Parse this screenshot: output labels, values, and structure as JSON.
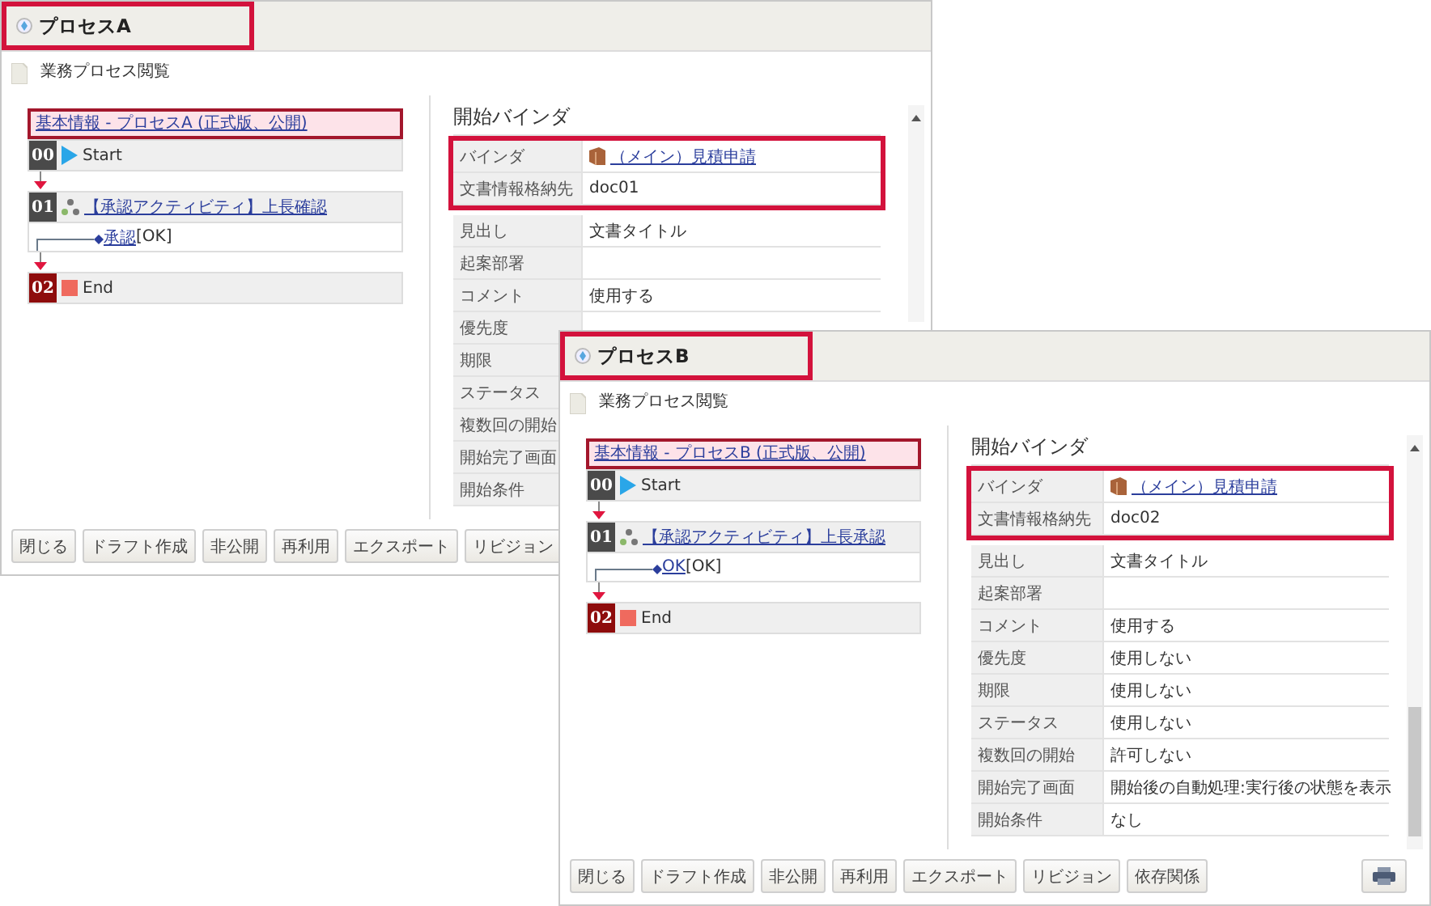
{
  "windows": [
    {
      "title": "プロセスA",
      "title_highlighted": true,
      "subtitle": "業務プロセス閲覧",
      "flow": {
        "header": "基本情報 - プロセスA (正式版、公開)",
        "steps": [
          {
            "number": "00",
            "kind": "start",
            "label": "Start"
          },
          {
            "number": "01",
            "kind": "activity",
            "label": "【承認アクティビティ】上長確認",
            "branch": {
              "link": "承認",
              "suffix": "[OK]"
            }
          },
          {
            "number": "02",
            "kind": "end",
            "label": "End"
          }
        ]
      },
      "panel": {
        "heading": "開始バインダ",
        "sections": [
          {
            "highlighted": true,
            "rows": [
              {
                "label": "バインダ",
                "kind": "link",
                "value": "（メイン）見積申請"
              },
              {
                "label": "文書情報格納先",
                "kind": "text",
                "value": "doc01"
              }
            ]
          },
          {
            "highlighted": false,
            "rows": [
              {
                "label": "見出し",
                "kind": "text",
                "value": "文書タイトル"
              },
              {
                "label": "起案部署",
                "kind": "text"
              },
              {
                "label": "コメント",
                "kind": "text",
                "value": "使用する"
              },
              {
                "label": "優先度",
                "kind": "text"
              },
              {
                "label": "期限",
                "kind": "text"
              },
              {
                "label": "ステータス",
                "kind": "text"
              },
              {
                "label": "複数回の開始",
                "kind": "text"
              },
              {
                "label": "開始完了画面",
                "kind": "text"
              },
              {
                "label": "開始条件",
                "kind": "text"
              }
            ]
          }
        ]
      },
      "buttons": [
        {
          "kind": "text",
          "label": "閉じる"
        },
        {
          "kind": "text",
          "label": "ドラフト作成"
        },
        {
          "kind": "text",
          "label": "非公開"
        },
        {
          "kind": "text",
          "label": "再利用"
        },
        {
          "kind": "text",
          "label": "エクスポート"
        },
        {
          "kind": "text",
          "label": "リビジョン"
        }
      ]
    },
    {
      "title": "プロセスB",
      "title_highlighted": true,
      "subtitle": "業務プロセス閲覧",
      "flow": {
        "header": "基本情報 - プロセスB (正式版、公開)",
        "steps": [
          {
            "number": "00",
            "kind": "start",
            "label": "Start"
          },
          {
            "number": "01",
            "kind": "activity",
            "label": "【承認アクティビティ】上長承認",
            "branch": {
              "link": "OK",
              "suffix": "[OK]"
            }
          },
          {
            "number": "02",
            "kind": "end",
            "label": "End"
          }
        ]
      },
      "panel": {
        "heading": "開始バインダ",
        "sections": [
          {
            "highlighted": true,
            "rows": [
              {
                "label": "バインダ",
                "kind": "link",
                "value": "（メイン）見積申請"
              },
              {
                "label": "文書情報格納先",
                "kind": "text",
                "value": "doc02"
              }
            ]
          },
          {
            "highlighted": false,
            "rows": [
              {
                "label": "見出し",
                "kind": "text",
                "value": "文書タイトル"
              },
              {
                "label": "起案部署",
                "kind": "text"
              },
              {
                "label": "コメント",
                "kind": "text",
                "value": "使用する"
              },
              {
                "label": "優先度",
                "kind": "text",
                "value": "使用しない"
              },
              {
                "label": "期限",
                "kind": "text",
                "value": "使用しない"
              },
              {
                "label": "ステータス",
                "kind": "text",
                "value": "使用しない"
              },
              {
                "label": "複数回の開始",
                "kind": "text",
                "value": "許可しない"
              },
              {
                "label": "開始完了画面",
                "kind": "text",
                "value": "開始後の自動処理:実行後の状態を表示"
              },
              {
                "label": "開始条件",
                "kind": "text",
                "value": "なし"
              }
            ]
          }
        ]
      },
      "buttons": [
        {
          "kind": "text",
          "label": "閉じる"
        },
        {
          "kind": "text",
          "label": "ドラフト作成"
        },
        {
          "kind": "text",
          "label": "非公開"
        },
        {
          "kind": "text",
          "label": "再利用"
        },
        {
          "kind": "text",
          "label": "エクスポート"
        },
        {
          "kind": "text",
          "label": "リビジョン"
        },
        {
          "kind": "text",
          "label": "依存関係"
        },
        {
          "kind": "print"
        }
      ]
    }
  ]
}
